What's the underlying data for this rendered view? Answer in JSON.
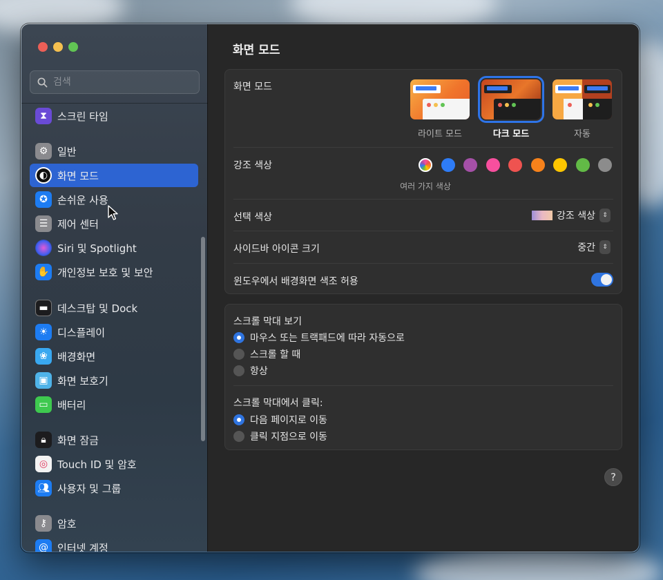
{
  "window_title": "화면 모드",
  "search": {
    "placeholder": "검색"
  },
  "sidebar": {
    "items": [
      {
        "label": "스크린 타임",
        "icon": "hourglass-icon"
      },
      {
        "label": "일반",
        "icon": "gear-icon"
      },
      {
        "label": "화면 모드",
        "icon": "appearance-icon",
        "active": true
      },
      {
        "label": "손쉬운 사용",
        "icon": "accessibility-icon"
      },
      {
        "label": "제어 센터",
        "icon": "control-center-icon"
      },
      {
        "label": "Siri 및 Spotlight",
        "icon": "siri-icon"
      },
      {
        "label": "개인정보 보호 및 보안",
        "icon": "hand-icon"
      },
      {
        "label": "데스크탑 및 Dock",
        "icon": "dock-icon"
      },
      {
        "label": "디스플레이",
        "icon": "sun-icon"
      },
      {
        "label": "배경화면",
        "icon": "flower-icon"
      },
      {
        "label": "화면 보호기",
        "icon": "screensaver-icon"
      },
      {
        "label": "배터리",
        "icon": "battery-icon"
      },
      {
        "label": "화면 잠금",
        "icon": "lock-icon"
      },
      {
        "label": "Touch ID 및 암호",
        "icon": "fingerprint-icon"
      },
      {
        "label": "사용자 및 그룹",
        "icon": "users-icon"
      },
      {
        "label": "암호",
        "icon": "key-icon"
      },
      {
        "label": "인터넷 계정",
        "icon": "at-icon"
      }
    ]
  },
  "appearance": {
    "label": "화면 모드",
    "options": [
      {
        "label": "라이트 모드",
        "selected": false
      },
      {
        "label": "다크 모드",
        "selected": true
      },
      {
        "label": "자동",
        "selected": false
      }
    ]
  },
  "accent": {
    "label": "강조 색상",
    "caption": "여러 가지 색상",
    "colors": [
      "multicolor",
      "#2e7cf6",
      "#a550a7",
      "#f74f9e",
      "#ef5350",
      "#f7821b",
      "#ffc600",
      "#62ba46",
      "#8c8c8c"
    ]
  },
  "highlight": {
    "label": "선택 색상",
    "value": "강조 색상"
  },
  "sidebar_icon_size": {
    "label": "사이드바 아이콘 크기",
    "value": "중간"
  },
  "wallpaper_tinting": {
    "label": "윈도우에서 배경화면 색조 허용",
    "enabled": true
  },
  "scroll_bars": {
    "label": "스크롤 막대 보기",
    "options": [
      {
        "label": "마우스 또는 트랙패드에 따라 자동으로",
        "selected": true
      },
      {
        "label": "스크롤 할 때",
        "selected": false
      },
      {
        "label": "항상",
        "selected": false
      }
    ]
  },
  "scroll_click": {
    "label": "스크롤 막대에서 클릭:",
    "options": [
      {
        "label": "다음 페이지로 이동",
        "selected": true
      },
      {
        "label": "클릭 지점으로 이동",
        "selected": false
      }
    ]
  },
  "help": "?"
}
